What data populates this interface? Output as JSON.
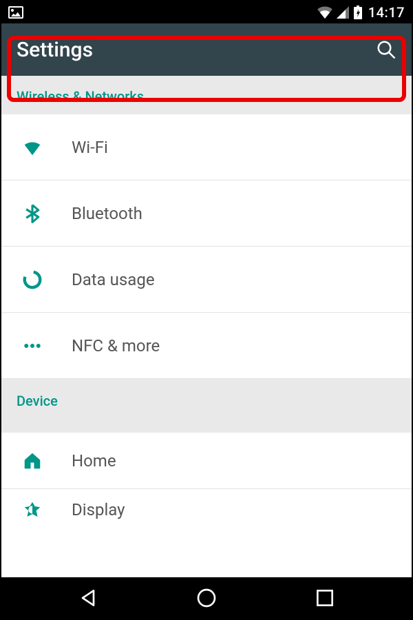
{
  "status": {
    "time": "14:17"
  },
  "header": {
    "title": "Settings"
  },
  "sections": {
    "wireless": {
      "header": "Wireless & Networks",
      "items": {
        "wifi": "Wi-Fi",
        "bluetooth": "Bluetooth",
        "data": "Data usage",
        "nfc": "NFC & more"
      }
    },
    "device": {
      "header": "Device",
      "items": {
        "home": "Home",
        "display": "Display"
      }
    }
  },
  "colors": {
    "accent": "#009688",
    "highlight": "#eb0000",
    "headerBg": "#32444c"
  }
}
